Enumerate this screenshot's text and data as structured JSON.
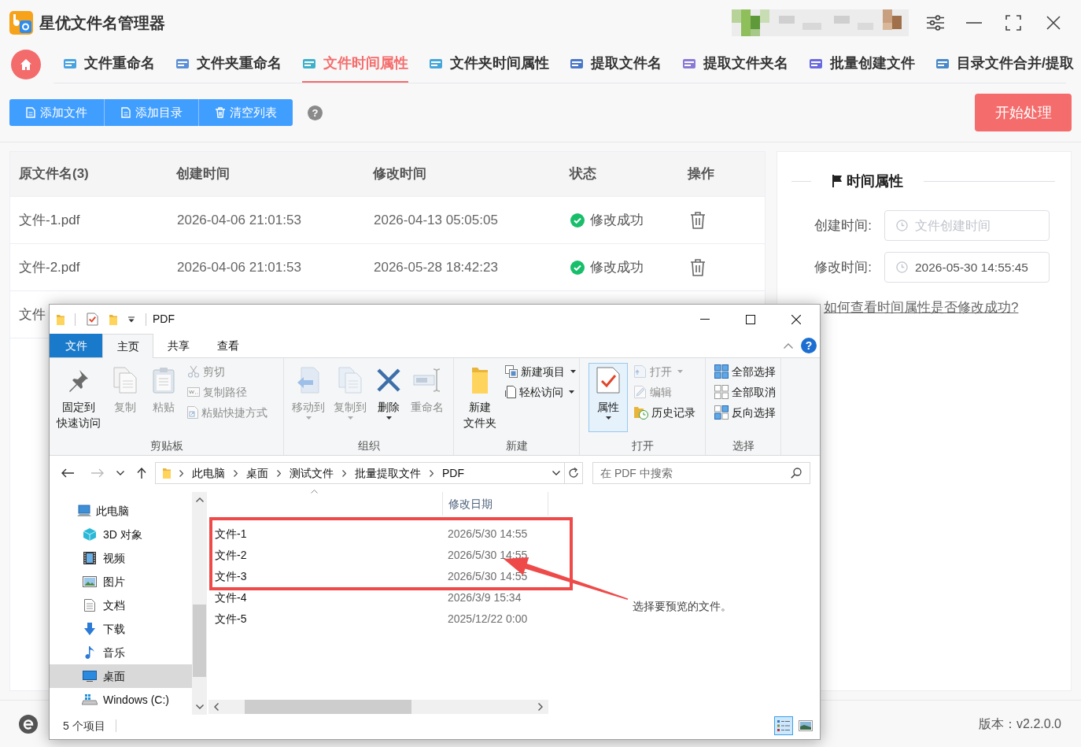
{
  "app": {
    "title": "星优文件名管理器"
  },
  "nav_tabs": [
    {
      "label": "文件重命名",
      "selected": false
    },
    {
      "label": "文件夹重命名",
      "selected": false
    },
    {
      "label": "文件时间属性",
      "selected": true
    },
    {
      "label": "文件夹时间属性",
      "selected": false
    },
    {
      "label": "提取文件名",
      "selected": false
    },
    {
      "label": "提取文件夹名",
      "selected": false
    },
    {
      "label": "批量创建文件",
      "selected": false
    },
    {
      "label": "目录文件合并/提取",
      "selected": false
    }
  ],
  "toolbar": {
    "buttons": [
      {
        "label": "添加文件",
        "kind": "file"
      },
      {
        "label": "添加目录",
        "kind": "file"
      },
      {
        "label": "清空列表",
        "kind": "trash"
      }
    ],
    "help": "?",
    "start_button": "开始处理"
  },
  "table": {
    "columns": [
      "原文件名(3)",
      "创建时间",
      "修改时间",
      "状态",
      "操作"
    ],
    "rows": [
      {
        "name": "文件-1.pdf",
        "created": "2026-04-06 21:01:53",
        "modified": "2026-04-13 05:05:05",
        "status": "修改成功"
      },
      {
        "name": "文件-2.pdf",
        "created": "2026-04-06 21:01:53",
        "modified": "2026-05-28 18:42:23",
        "status": "修改成功"
      },
      {
        "name": "文件"
      }
    ]
  },
  "time_panel": {
    "title": "时间属性",
    "fields": [
      {
        "label": "创建时间:",
        "placeholder": "文件创建时间"
      },
      {
        "label": "修改时间:",
        "value": "2026-05-30 14:55:45"
      }
    ],
    "help_link": "如何查看时间属性是否修改成功?"
  },
  "footer": {
    "version": "版本：v2.2.0.0"
  },
  "explorer": {
    "title": "PDF",
    "ribbon_tabs": [
      {
        "label": "文件",
        "kind": "menu",
        "selected": false
      },
      {
        "label": "主页",
        "kind": "tab",
        "selected": true
      },
      {
        "label": "共享",
        "kind": "tab",
        "selected": false
      },
      {
        "label": "查看",
        "kind": "tab",
        "selected": false
      }
    ],
    "help": "?",
    "ribbon_groups": [
      {
        "label": "剪贴板",
        "items": [
          {
            "lines": [
              "固定到",
              "快速访问"
            ],
            "kind": "large",
            "disabled": false
          },
          {
            "label": "复制",
            "kind": "large",
            "disabled": true
          },
          {
            "label": "粘贴",
            "kind": "large",
            "disabled": true
          },
          {
            "label": "剪切",
            "kind": "small",
            "disabled": true
          },
          {
            "label": "复制路径",
            "kind": "small",
            "disabled": true
          },
          {
            "label": "粘贴快捷方式",
            "kind": "small",
            "disabled": true
          }
        ]
      },
      {
        "label": "组织",
        "items": [
          {
            "label": "移动到",
            "kind": "large",
            "disabled": true,
            "menu": true
          },
          {
            "label": "复制到",
            "kind": "large",
            "disabled": true,
            "menu": true
          },
          {
            "label": "删除",
            "kind": "large",
            "disabled": false,
            "menu": true
          },
          {
            "label": "重命名",
            "kind": "large",
            "disabled": true
          }
        ]
      },
      {
        "label": "新建",
        "items": [
          {
            "lines": [
              "新建",
              "文件夹"
            ],
            "kind": "large",
            "disabled": false
          },
          {
            "label": "新建项目",
            "kind": "small",
            "disabled": false,
            "menu": true
          },
          {
            "label": "轻松访问",
            "kind": "small",
            "disabled": false,
            "menu": true
          }
        ]
      },
      {
        "label": "打开",
        "items": [
          {
            "label": "属性",
            "kind": "large",
            "disabled": false,
            "menu": true,
            "highlighted": true
          },
          {
            "label": "打开",
            "kind": "small",
            "disabled": true,
            "menu": true
          },
          {
            "label": "编辑",
            "kind": "small",
            "disabled": true
          },
          {
            "label": "历史记录",
            "kind": "small",
            "disabled": false
          }
        ]
      },
      {
        "label": "选择",
        "items": [
          {
            "label": "全部选择",
            "kind": "small",
            "disabled": false
          },
          {
            "label": "全部取消",
            "kind": "small",
            "disabled": false
          },
          {
            "label": "反向选择",
            "kind": "small",
            "disabled": false
          }
        ]
      }
    ],
    "address": [
      "此电脑",
      "桌面",
      "测试文件",
      "批量提取文件",
      "PDF"
    ],
    "search": {
      "placeholder": "在 PDF 中搜索"
    },
    "nav_tree": [
      {
        "label": "此电脑",
        "selected": false,
        "children": [
          {
            "label": "3D 对象",
            "selected": false
          },
          {
            "label": "视频",
            "selected": false
          },
          {
            "label": "图片",
            "selected": false
          },
          {
            "label": "文档",
            "selected": false
          },
          {
            "label": "下载",
            "selected": false
          },
          {
            "label": "音乐",
            "selected": false
          },
          {
            "label": "桌面",
            "selected": true
          },
          {
            "label": "Windows (C:)",
            "selected": false
          }
        ]
      }
    ],
    "file_list": {
      "date_column": "修改日期",
      "files": [
        {
          "name": "文件-1",
          "modified": "2026/5/30 14:55"
        },
        {
          "name": "文件-2",
          "modified": "2026/5/30 14:55"
        },
        {
          "name": "文件-3",
          "modified": "2026/5/30 14:55"
        },
        {
          "name": "文件-4",
          "modified": "2026/3/9 15:34"
        },
        {
          "name": "文件-5",
          "modified": "2025/12/22 0:00"
        }
      ]
    },
    "preview_hint": "选择要预览的文件。",
    "status": "5 个项目",
    "views": [
      {
        "selected": true
      },
      {
        "selected": false
      }
    ]
  }
}
